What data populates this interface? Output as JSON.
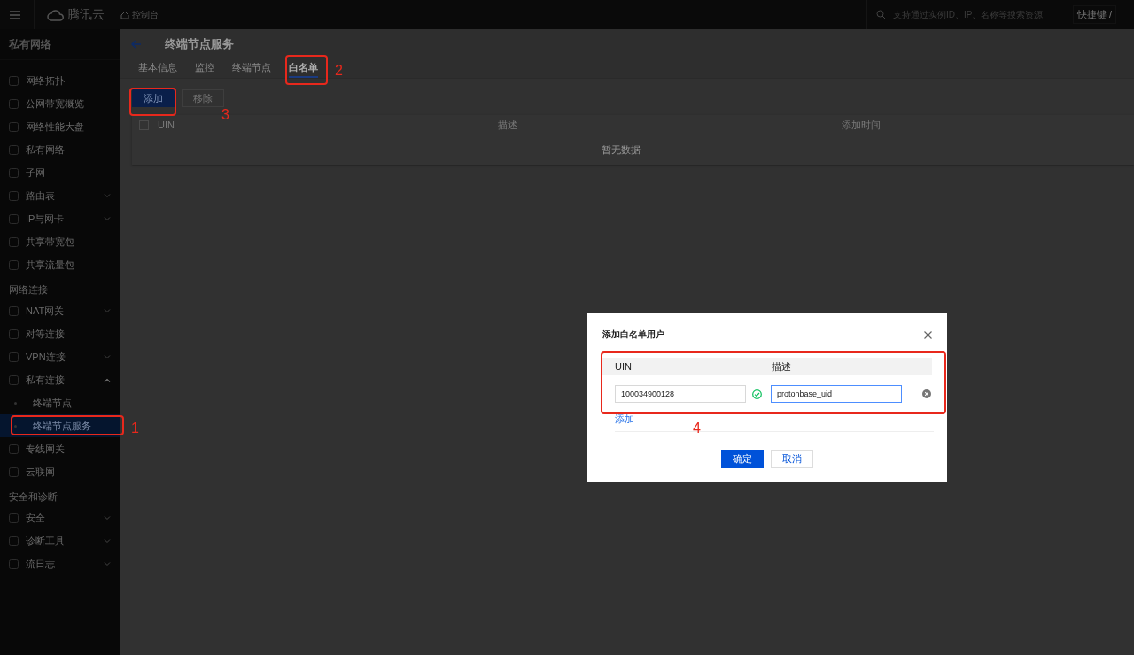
{
  "topbar": {
    "logo": "腾讯云",
    "console": "控制台",
    "search_placeholder": "支持通过实例ID、IP、名称等搜索资源",
    "shortcut": "快捷键 /"
  },
  "sidebar": {
    "title": "私有网络",
    "items": [
      {
        "kind": "item",
        "label": "网络拓扑",
        "selected": false
      },
      {
        "kind": "item",
        "label": "公网带宽概览",
        "selected": false
      },
      {
        "kind": "item",
        "label": "网络性能大盘",
        "selected": false
      },
      {
        "kind": "item",
        "label": "私有网络",
        "selected": false
      },
      {
        "kind": "item",
        "label": "子网",
        "selected": false
      },
      {
        "kind": "item",
        "label": "路由表",
        "selected": false,
        "expanded": false
      },
      {
        "kind": "item",
        "label": "IP与网卡",
        "selected": false,
        "expanded": false
      },
      {
        "kind": "item",
        "label": "共享带宽包",
        "selected": false
      },
      {
        "kind": "item",
        "label": "共享流量包",
        "selected": false
      },
      {
        "kind": "section",
        "label": "网络连接"
      },
      {
        "kind": "item",
        "label": "NAT网关",
        "selected": false,
        "expanded": false
      },
      {
        "kind": "item",
        "label": "对等连接",
        "selected": false
      },
      {
        "kind": "item",
        "label": "VPN连接",
        "selected": false,
        "expanded": false
      },
      {
        "kind": "item",
        "label": "私有连接",
        "selected": false,
        "expanded": true,
        "children": [
          {
            "label": "终端节点",
            "selected": false
          },
          {
            "label": "终端节点服务",
            "selected": true
          }
        ]
      },
      {
        "kind": "item",
        "label": "专线网关",
        "selected": false
      },
      {
        "kind": "item",
        "label": "云联网",
        "selected": false
      },
      {
        "kind": "section",
        "label": "安全和诊断"
      },
      {
        "kind": "item",
        "label": "安全",
        "selected": false,
        "expanded": false
      },
      {
        "kind": "item",
        "label": "诊断工具",
        "selected": false,
        "expanded": false
      },
      {
        "kind": "item",
        "label": "流日志",
        "selected": false,
        "expanded": false
      }
    ]
  },
  "page": {
    "title": "终端节点服务",
    "tabs": [
      {
        "label": "基本信息",
        "selected": false
      },
      {
        "label": "监控",
        "selected": false
      },
      {
        "label": "终端节点",
        "selected": false
      },
      {
        "label": "白名单",
        "selected": true
      }
    ],
    "buttons": [
      {
        "label": "添加",
        "kind": "primary"
      },
      {
        "label": "移除",
        "kind": "secondary"
      }
    ],
    "table": {
      "select_all_checked": false,
      "columns": [
        "UIN",
        "描述",
        "添加时间"
      ],
      "empty": "暂无数据"
    }
  },
  "dialog": {
    "title": "添加白名单用户",
    "columns": [
      "UIN",
      "描述"
    ],
    "rows": [
      {
        "uin": "100034900128",
        "valid": true,
        "description": "protonbase_uid"
      }
    ],
    "add_link": "添加",
    "buttons": [
      {
        "label": "确定",
        "kind": "primary"
      },
      {
        "label": "取消",
        "kind": "secondary"
      }
    ]
  },
  "annotations": [
    {
      "label": "1"
    },
    {
      "label": "2"
    },
    {
      "label": "3"
    },
    {
      "label": "4"
    }
  ]
}
